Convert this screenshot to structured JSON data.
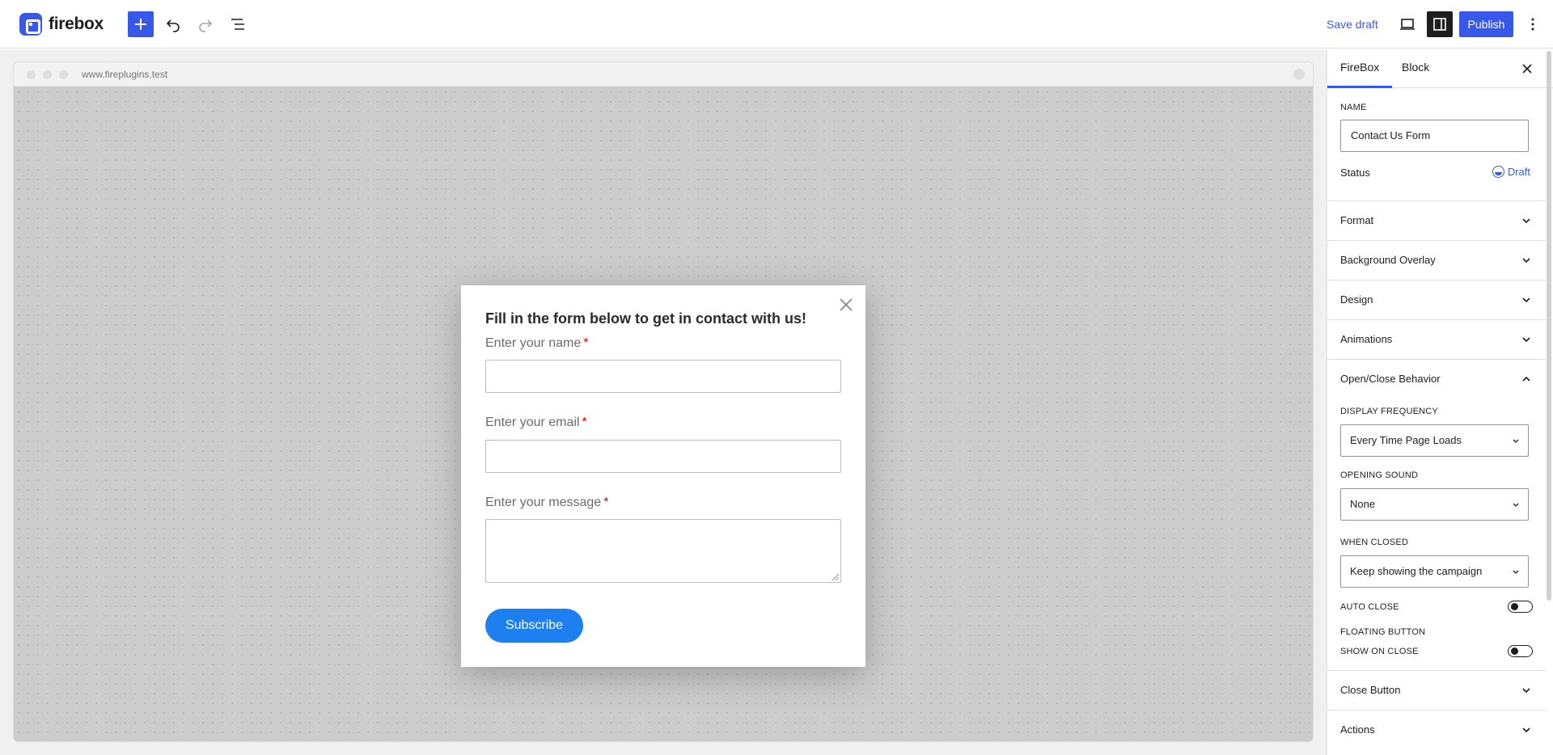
{
  "app": {
    "logo_text": "firebox",
    "save_draft_label": "Save draft",
    "publish_label": "Publish"
  },
  "canvas": {
    "url": "www.fireplugins.test"
  },
  "popup": {
    "title": "Fill in the form below to get in contact with us!",
    "fields": [
      {
        "label": "Enter your name",
        "required": "*"
      },
      {
        "label": "Enter your email",
        "required": "*"
      },
      {
        "label": "Enter your message",
        "required": "*"
      }
    ],
    "submit_label": "Subscribe"
  },
  "sidebar": {
    "tabs": [
      "FireBox",
      "Block"
    ],
    "name_label": "NAME",
    "name_value": "Contact Us Form",
    "status_label": "Status",
    "status_value": "Draft",
    "panels": {
      "format": "Format",
      "background_overlay": "Background Overlay",
      "design": "Design",
      "animations": "Animations",
      "open_close": "Open/Close Behavior",
      "close_button": "Close Button",
      "actions": "Actions"
    },
    "open_close": {
      "display_frequency_label": "DISPLAY FREQUENCY",
      "display_frequency_value": "Every Time Page Loads",
      "opening_sound_label": "OPENING SOUND",
      "opening_sound_value": "None",
      "when_closed_label": "WHEN CLOSED",
      "when_closed_value": "Keep showing the campaign",
      "auto_close_label": "AUTO CLOSE",
      "floating_button_label": "FLOATING BUTTON",
      "show_on_close_label": "SHOW ON CLOSE"
    }
  },
  "colors": {
    "accent": "#3858e9",
    "subscribe": "#1d7ff0",
    "required": "#e00000"
  }
}
